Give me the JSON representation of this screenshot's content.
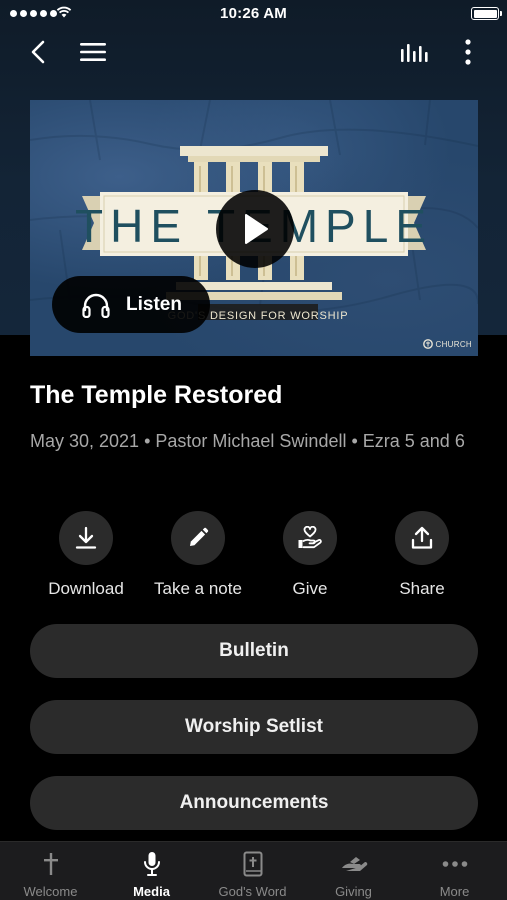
{
  "status_bar": {
    "time": "10:26 AM"
  },
  "nav": {
    "back_icon": "chevron-left-icon",
    "menu_icon": "hamburger-menu-icon",
    "audio_icon": "audio-levels-icon",
    "more_icon": "vertical-dots-icon"
  },
  "artwork": {
    "title_word": "THE TEMPLE",
    "subtitle": "GOD'S DESIGN FOR WORSHIP",
    "logo_text": "CHURCH",
    "listen_label": "Listen",
    "play_icon": "play-icon",
    "listen_icon": "headphones-icon"
  },
  "sermon": {
    "title": "The Temple Restored",
    "meta": "May 30, 2021 • Pastor Michael Swindell • Ezra 5 and 6"
  },
  "actions": [
    {
      "label": "Download",
      "icon": "download-icon"
    },
    {
      "label": "Take a note",
      "icon": "pencil-icon"
    },
    {
      "label": "Give",
      "icon": "give-hand-heart-icon"
    },
    {
      "label": "Share",
      "icon": "share-icon"
    }
  ],
  "buttons": [
    {
      "label": "Bulletin"
    },
    {
      "label": "Worship Setlist"
    },
    {
      "label": "Announcements"
    }
  ],
  "tabs": [
    {
      "label": "Welcome",
      "icon": "cross-icon",
      "active": false
    },
    {
      "label": "Media",
      "icon": "microphone-icon",
      "active": true
    },
    {
      "label": "God's Word",
      "icon": "bible-icon",
      "active": false
    },
    {
      "label": "Giving",
      "icon": "giving-hand-icon",
      "active": false
    },
    {
      "label": "More",
      "icon": "horizontal-dots-icon",
      "active": false
    }
  ],
  "colors": {
    "background": "#000000",
    "header_gradient": "#14263a",
    "surface": "#2b2b2b",
    "tab_bar": "#1c1c1e",
    "muted_text": "#a8a8a8",
    "art_blue": "#27476c",
    "art_cream": "#ede6cf",
    "art_teal": "#1f4f5f"
  }
}
